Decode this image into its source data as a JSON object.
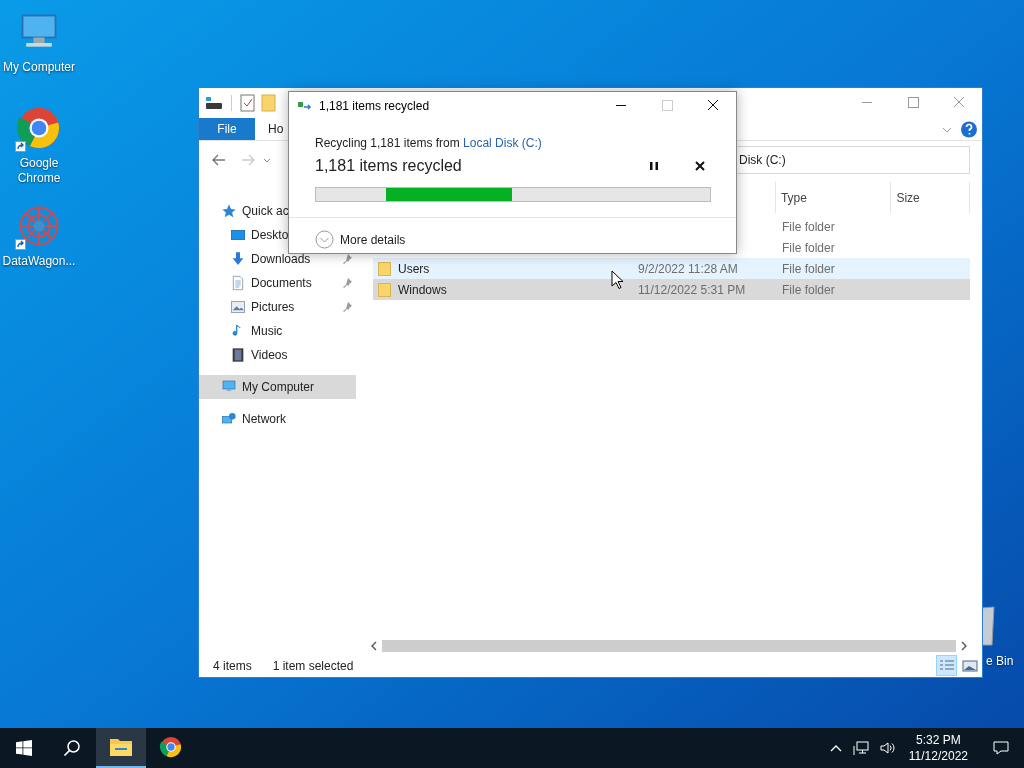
{
  "desktop_icons": [
    {
      "kind": "computer",
      "label": "My Computer"
    },
    {
      "kind": "chrome",
      "label": "Google Chrome"
    },
    {
      "kind": "app",
      "label": "DataWagon..."
    }
  ],
  "recycle_bin_label": "e Bin",
  "explorer": {
    "ribbon_tabs": [
      {
        "kind": "file",
        "label": "File"
      },
      {
        "kind": "tab",
        "label": "Ho"
      }
    ],
    "address": "Disk (C:)",
    "sidebar": [
      {
        "kind": "star",
        "label": "Quick ac",
        "selected": false,
        "children": [
          {
            "kind": "desktop",
            "label": "Deskto"
          },
          {
            "kind": "downloads",
            "label": "Downloads",
            "pinned": true
          },
          {
            "kind": "documents",
            "label": "Documents",
            "pinned": true
          },
          {
            "kind": "pictures",
            "label": "Pictures",
            "pinned": true
          },
          {
            "kind": "music",
            "label": "Music",
            "pinned": false
          },
          {
            "kind": "videos",
            "label": "Videos",
            "pinned": false
          }
        ]
      },
      {
        "kind": "computer",
        "label": "My Computer",
        "selected": true
      },
      {
        "kind": "network",
        "label": "Network",
        "selected": false
      }
    ],
    "columns": [
      "Type",
      "Size"
    ],
    "rows": [
      {
        "type": "File folder",
        "hovered": false,
        "selected": false
      },
      {
        "type": "File folder",
        "hovered": false,
        "selected": false
      },
      {
        "name": "Users",
        "date": "9/2/2022 11:28 AM",
        "type": "File folder",
        "hovered": true,
        "selected": false
      },
      {
        "name": "Windows",
        "date": "11/12/2022 5:31 PM",
        "type": "File folder",
        "hovered": false,
        "selected": true
      }
    ],
    "status_bar": {
      "item_count": "4 items",
      "selection": "1 item selected"
    },
    "views": [
      {
        "kind": "details",
        "selected": true
      },
      {
        "kind": "thumbnails",
        "selected": false
      }
    ]
  },
  "dialog": {
    "title": "1,181 items recycled",
    "summary": "Recycling 1,181 items from ",
    "source_link": "Local Disk (C:)",
    "heading": "1,181 items recycled",
    "level": 0.32,
    "more_details": "More details"
  },
  "taskbar": {
    "apps": [
      {
        "kind": "explorer",
        "active": true
      },
      {
        "kind": "chrome",
        "active": false
      }
    ],
    "time": "5:32 PM",
    "date": "11/12/2022"
  }
}
